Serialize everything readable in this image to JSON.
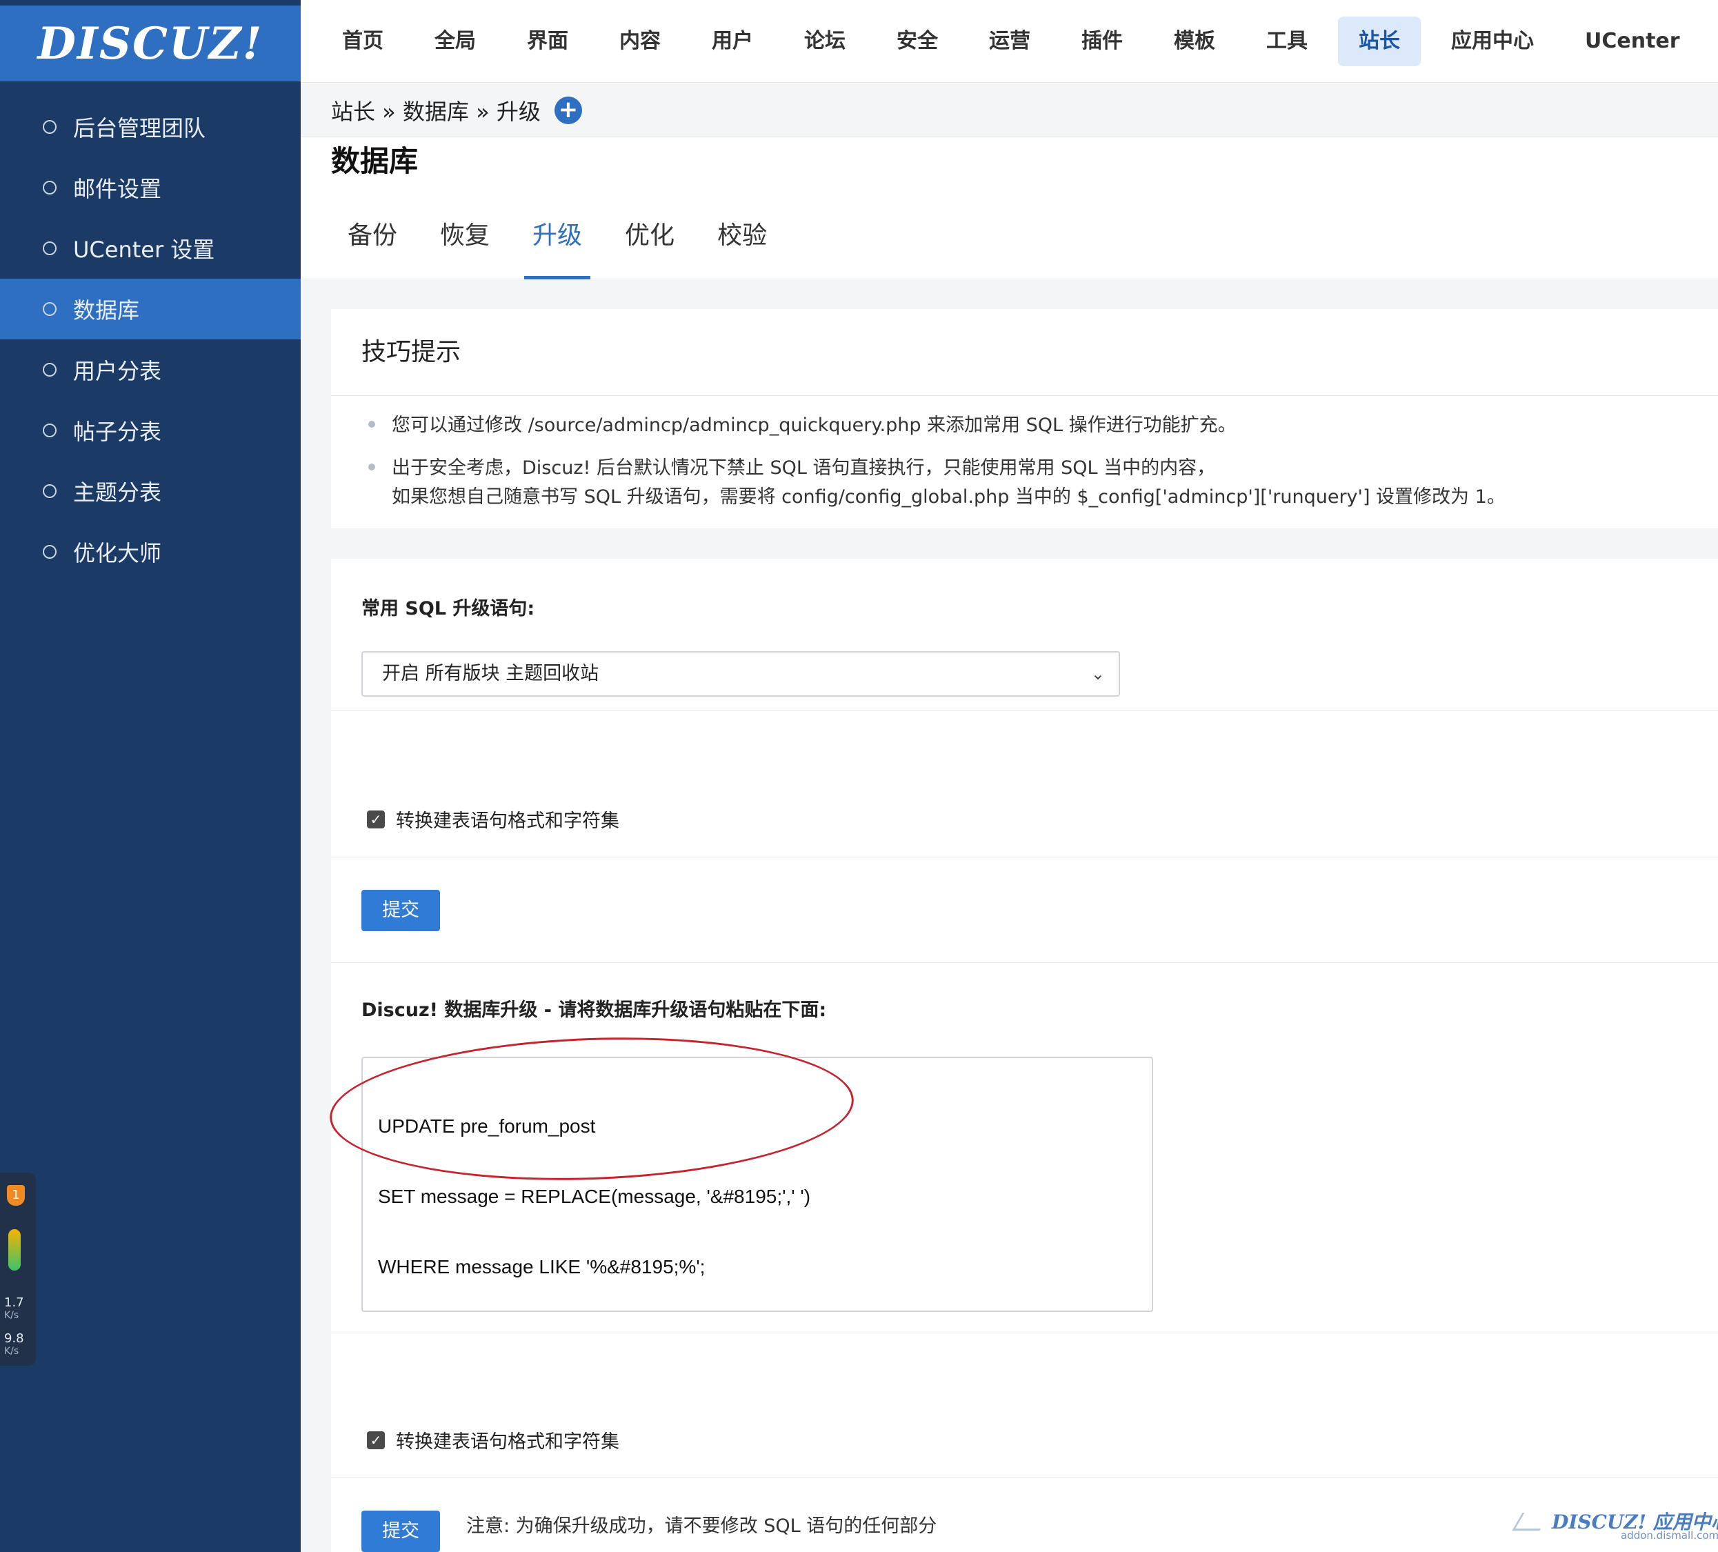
{
  "logo": {
    "text": "DISCUZ!"
  },
  "sidebar": {
    "items": [
      {
        "label": "后台管理团队"
      },
      {
        "label": "邮件设置"
      },
      {
        "label": "UCenter 设置"
      },
      {
        "label": "数据库",
        "active": true
      },
      {
        "label": "用户分表"
      },
      {
        "label": "帖子分表"
      },
      {
        "label": "主题分表"
      },
      {
        "label": "优化大师"
      }
    ]
  },
  "topnav": {
    "items": [
      "首页",
      "全局",
      "界面",
      "内容",
      "用户",
      "论坛",
      "安全",
      "运营",
      "插件",
      "模板",
      "工具",
      "站长",
      "应用中心",
      "UCenter"
    ],
    "active": "站长"
  },
  "breadcrumb": {
    "text": "站长 » 数据库 » 升级",
    "plus": "+"
  },
  "page_title": "数据库",
  "tabs": {
    "items": [
      "备份",
      "恢复",
      "升级",
      "优化",
      "校验"
    ],
    "active": "升级"
  },
  "tips": {
    "title": "技巧提示",
    "items": [
      {
        "line1": "您可以通过修改 /source/admincp/admincp_quickquery.php 来添加常用 SQL 操作进行功能扩充。",
        "line2": ""
      },
      {
        "line1": "出于安全考虑，Discuz! 后台默认情况下禁止 SQL 语句直接执行，只能使用常用 SQL 当中的内容，",
        "line2": "如果您想自己随意书写 SQL 升级语句，需要将 config/config_global.php 当中的 $_config['admincp']['runquery'] 设置修改为 1。"
      }
    ]
  },
  "form": {
    "common_sql_label": "常用 SQL 升级语句:",
    "select_value": "开启 所有版块 主题回收站",
    "convert_label_1": "转换建表语句格式和字符集",
    "submit_label_1": "提交",
    "upgrade_label": "Discuz! 数据库升级 - 请将数据库升级语句粘贴在下面:",
    "sql_lines": [
      "UPDATE pre_forum_post",
      "SET message = REPLACE(message, '&#8195;',' ')",
      "WHERE message LIKE '%&#8195;%';"
    ],
    "convert_label_2": "转换建表语句格式和字符集",
    "submit_label_2": "提交",
    "note": "注意: 为确保升级成功，请不要修改 SQL 语句的任何部分"
  },
  "net_widget": {
    "up_value": "1.7",
    "up_unit": "K/s",
    "down_value": "9.8",
    "down_unit": "K/s",
    "badge": "1"
  },
  "watermark": {
    "main": "DISCUZ! 应用中心",
    "sub": "addon.dismall.com"
  },
  "colors": {
    "sidebar": "#1c3a66",
    "accent": "#2f6fc2",
    "annotation_ring": "#c8232c"
  }
}
